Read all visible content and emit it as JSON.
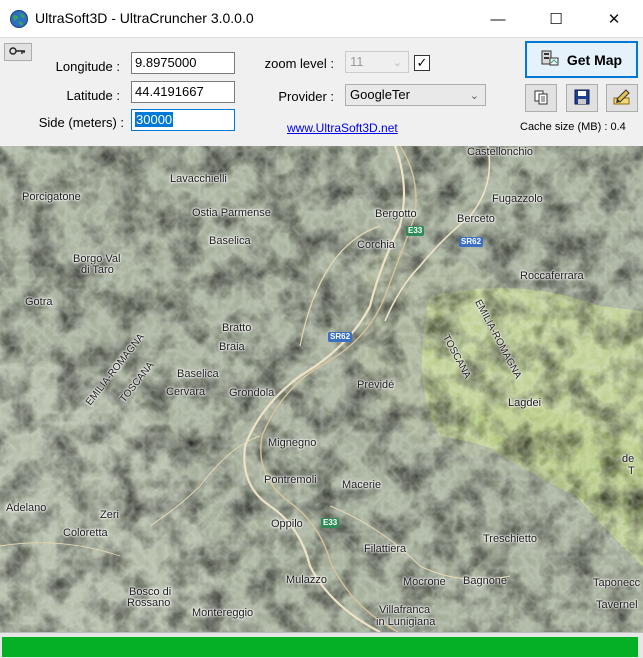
{
  "window": {
    "title": "UltraSoft3D - UltraCruncher 3.0.0.0",
    "minimize_glyph": "—",
    "maximize_glyph": "☐",
    "close_glyph": "✕",
    "app_icon": "globe-icon"
  },
  "form": {
    "longitude_label": "Longitude :",
    "longitude_value": "9.8975000",
    "latitude_label": "Latitude :",
    "latitude_value": "44.4191667",
    "side_label": "Side (meters) :",
    "side_value": "30000",
    "zoom_label": "zoom level :",
    "zoom_value": "11",
    "zoom_enabled": false,
    "zoom_checkbox_checked": true,
    "checkbox_glyph": "✓",
    "provider_label": "Provider :",
    "provider_value": "GoogleTer",
    "combo_arrow": "⌄",
    "website_link": "www.UltraSoft3D.net"
  },
  "toolbar": {
    "get_map_label": "Get Map",
    "get_map_icon": "map-server-icon",
    "copy_icon": "copy-icon",
    "save_icon": "save-icon",
    "edit_icon": "edit-icon",
    "key_icon": "key-icon",
    "cache_text": "Cache size (MB) : 0.4"
  },
  "map": {
    "places": [
      "Castellonchio",
      "Porcigatone",
      "Lavacchielli",
      "Fugazzolo",
      "Ostia Parmense",
      "Bergotto",
      "Berceto",
      "Baselica",
      "Corchia",
      "Borgo Val",
      "di Taro",
      "Roccaferrara",
      "Gotra",
      "Bratto",
      "Braia",
      "Baselica",
      "Previdé",
      "Lagdei",
      "Cervara",
      "Grondola",
      "Mignegno",
      "Pontremoli",
      "Macerie",
      "Adelano",
      "Zeri",
      "Coloretta",
      "Oppilo",
      "Treschietto",
      "Filattiera",
      "Mulazzo",
      "Mocrone",
      "Bagnone",
      "Bosco di",
      "Rossano",
      "Montereggio",
      "Villafranca",
      "in Lunigiana",
      "Taponecc",
      "Tavernel",
      "de",
      "T"
    ],
    "region_labels": [
      "EMILIA-ROMAGNA",
      "TOSCANA",
      "TOSCANA",
      "EMILIA-ROMAGNA"
    ],
    "road_shields": [
      "E33",
      "SR62",
      "SR62",
      "E33"
    ]
  },
  "status": {
    "progress_fraction": 0.995,
    "progress_color": "#06b025"
  }
}
